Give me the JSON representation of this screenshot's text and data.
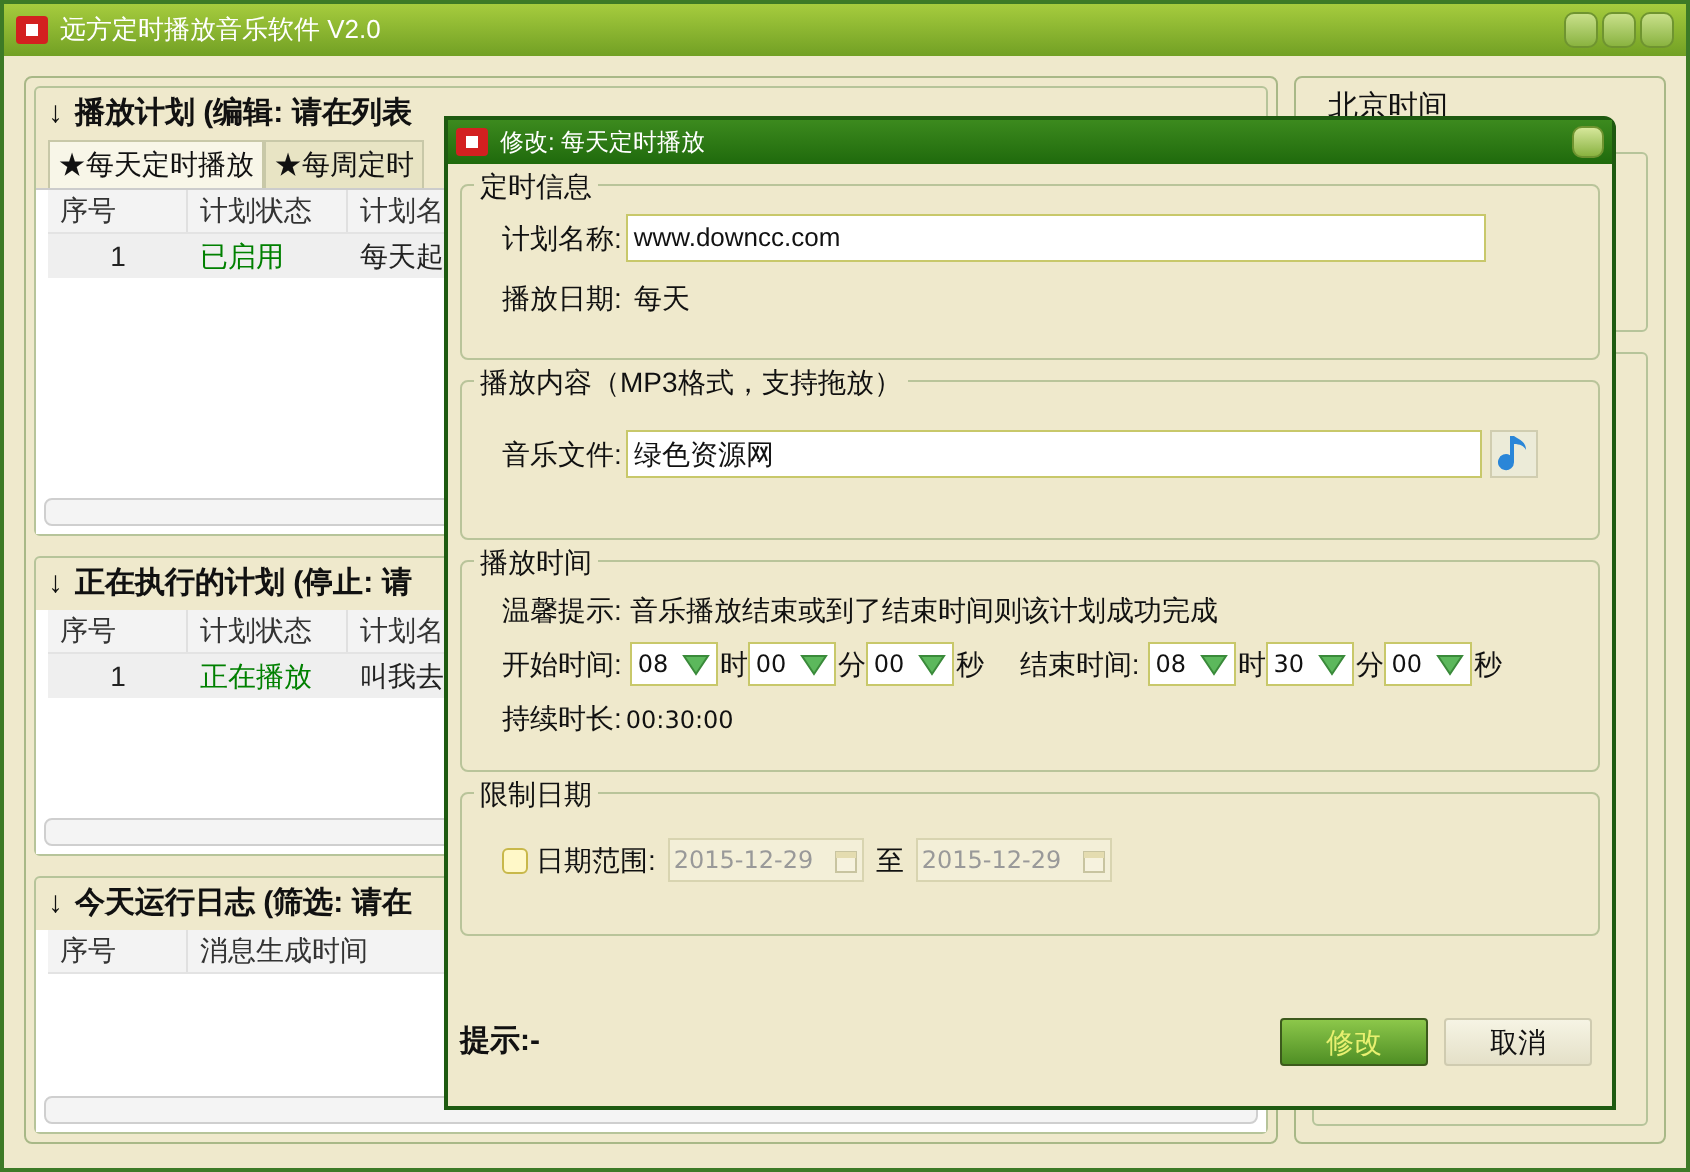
{
  "window": {
    "title": "远方定时播放音乐软件 V2.0"
  },
  "plan_panel": {
    "arrow": "↓",
    "title": "播放计划 (编辑: 请在列表",
    "tabs": [
      {
        "label": "★每天定时播放",
        "selected": true
      },
      {
        "label": "★每周定时",
        "selected": false
      }
    ],
    "columns": [
      "序号",
      "计划状态",
      "计划名"
    ],
    "rows": [
      {
        "cells": [
          "1",
          "已启用",
          "每天起"
        ]
      }
    ]
  },
  "running_panel": {
    "arrow": "↓",
    "title": "正在执行的计划 (停止: 请",
    "columns": [
      "序号",
      "计划状态",
      "计划名"
    ],
    "rows": [
      {
        "cells": [
          "1",
          "正在播放",
          "叫我去"
        ]
      }
    ]
  },
  "log_panel": {
    "arrow": "↓",
    "title": "今天运行日志 (筛选: 请在",
    "columns": [
      "序号",
      "消息生成时间"
    ]
  },
  "clock_panel": {
    "title": "北京时间"
  },
  "dialog": {
    "title": "修改: 每天定时播放",
    "schedule_group": {
      "title": "定时信息",
      "name_label": "计划名称:",
      "name_value": "www.downcc.com",
      "date_label": "播放日期:",
      "date_value": "每天"
    },
    "content_group": {
      "title": "播放内容（MP3格式，支持拖放）",
      "file_label": "音乐文件:",
      "file_value": "绿色资源网"
    },
    "time_group": {
      "title": "播放时间",
      "tip": "温馨提示: 音乐播放结束或到了结束时间则该计划成功完成",
      "start_label": "开始时间:",
      "start": [
        {
          "value": "08",
          "unit": "时"
        },
        {
          "value": "00",
          "unit": "分"
        },
        {
          "value": "00",
          "unit": "秒"
        }
      ],
      "end_label": "结束时间:",
      "end": [
        {
          "value": "08",
          "unit": "时"
        },
        {
          "value": "30",
          "unit": "分"
        },
        {
          "value": "00",
          "unit": "秒"
        }
      ],
      "duration_label": "持续时长:",
      "duration": "00:30:00"
    },
    "limit_group": {
      "title": "限制日期",
      "range_checked": false,
      "range_label": "日期范围:",
      "from": "2015-12-29",
      "to_label": "至",
      "to": "2015-12-29"
    },
    "hint": "提示:-",
    "buttons": [
      {
        "label": "修改",
        "kind": "primary"
      },
      {
        "label": "取消",
        "kind": "secondary"
      }
    ]
  }
}
